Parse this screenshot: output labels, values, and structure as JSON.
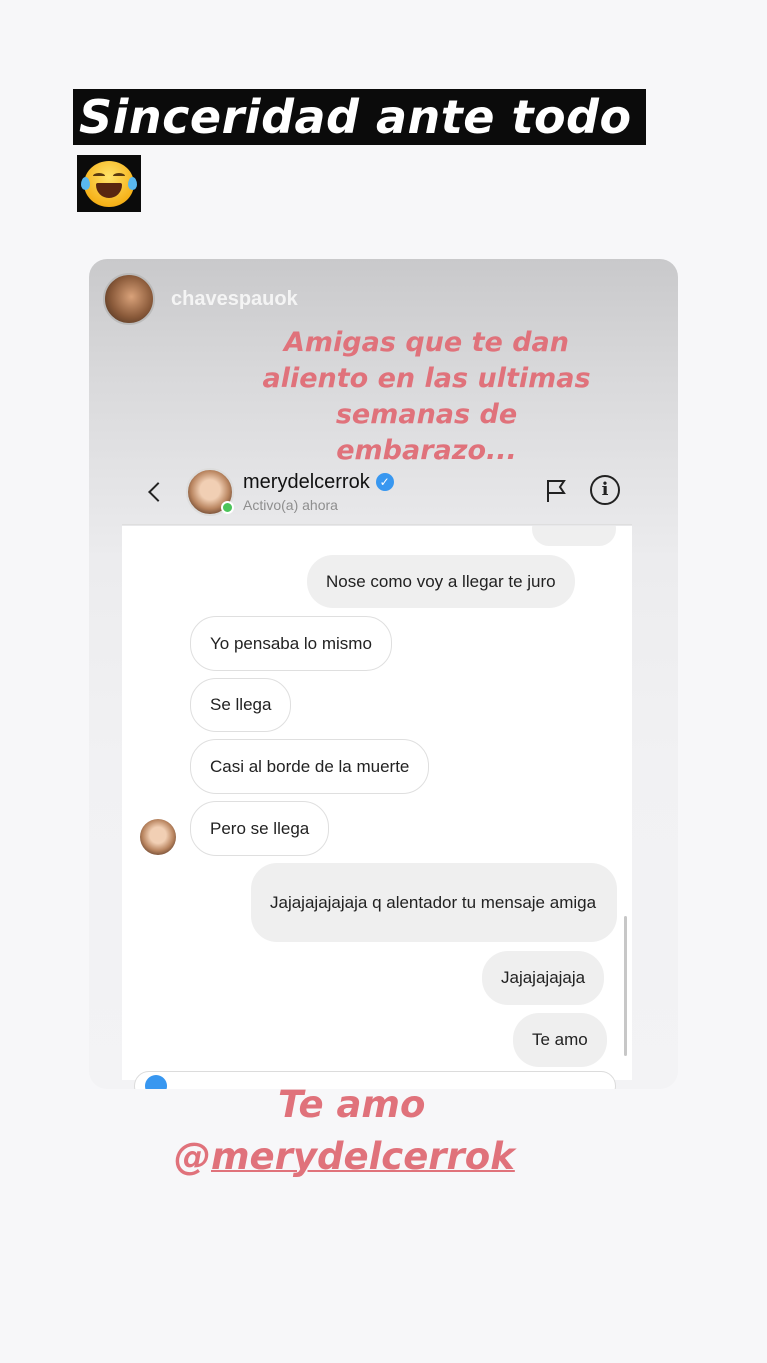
{
  "story": {
    "title": "Sinceridad ante todo",
    "emoji": "face-with-tears-of-joy-icon"
  },
  "shared_post": {
    "username": "chavespauok",
    "caption_lines": [
      "Amigas que te dan",
      "aliento en las ultimas",
      "semanas de",
      "embarazo..."
    ]
  },
  "dm": {
    "contact_name": "merydelcerrok",
    "status": "Activo(a) ahora",
    "verified": true,
    "messages": [
      {
        "side": "out",
        "text": "Nose como voy a llegar te juro"
      },
      {
        "side": "in",
        "text": "Yo pensaba lo mismo"
      },
      {
        "side": "in",
        "text": "Se llega"
      },
      {
        "side": "in",
        "text": "Casi al borde de la muerte"
      },
      {
        "side": "in",
        "text": "Pero se llega"
      },
      {
        "side": "out",
        "text": "Jajajajajajaja q alentador tu mensaje amiga"
      },
      {
        "side": "out",
        "text": "Jajajajajaja"
      },
      {
        "side": "out",
        "text": "Te amo"
      }
    ]
  },
  "footer": {
    "line1": "Te amo",
    "at": "@",
    "mention": "merydelcerrok"
  },
  "colors": {
    "caption": "#e0727b",
    "verified": "#3897f0",
    "online": "#4bc45a"
  }
}
